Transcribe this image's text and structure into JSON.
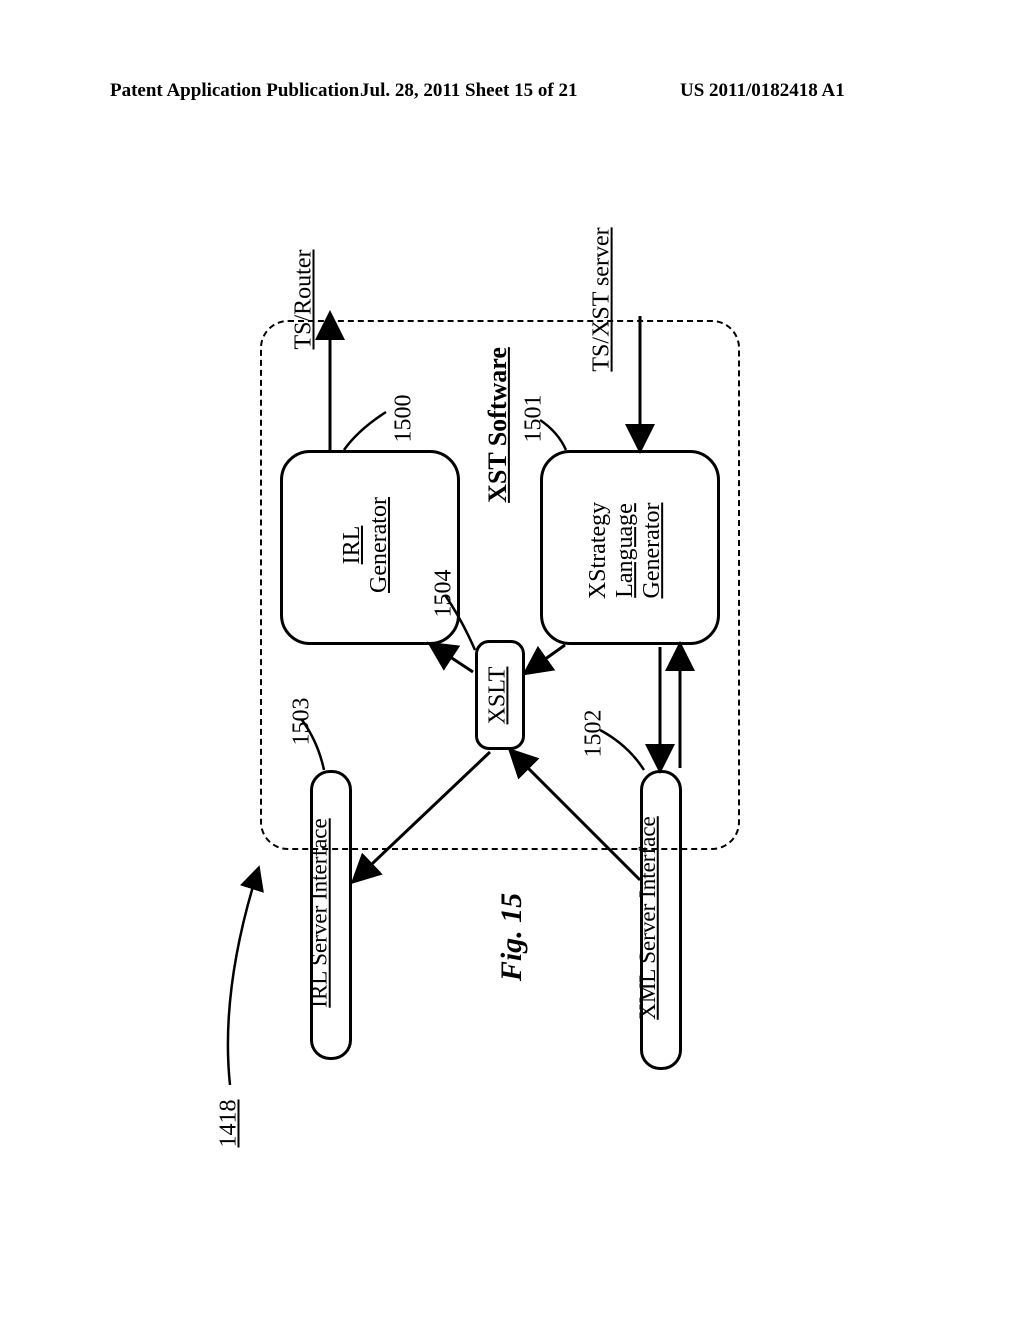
{
  "header": {
    "left": "Patent Application Publication",
    "mid": "Jul. 28, 2011  Sheet 15 of 21",
    "right": "US 2011/0182418 A1"
  },
  "figure_caption": "Fig. 15",
  "external": {
    "ts_router": "TS/Router",
    "ts_xst_server": "TS/XST server"
  },
  "title": "XST Software",
  "boxes": {
    "irl_generator_l1": "IRL",
    "irl_generator_l2": "Generator",
    "xstrategy_l1": "XStrategy",
    "xstrategy_l2": "Language",
    "xstrategy_l3": "Generator",
    "xslt": "XSLT",
    "irl_server_iface": "IRL Server Interface",
    "xml_server_iface": "XML Server Interface"
  },
  "labels": {
    "l1418": "1418",
    "l1500": "1500",
    "l1501": "1501",
    "l1502": "1502",
    "l1503": "1503",
    "l1504": "1504"
  }
}
